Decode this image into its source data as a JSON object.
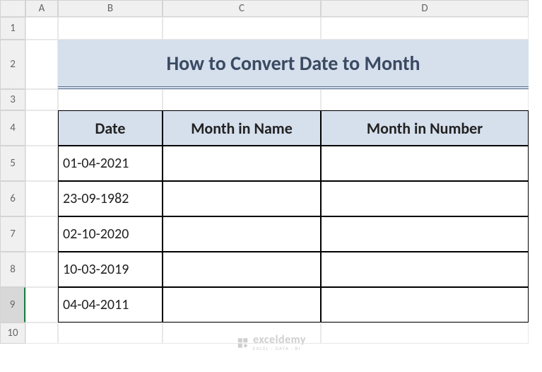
{
  "columns": [
    "A",
    "B",
    "C",
    "D"
  ],
  "rows": [
    "1",
    "2",
    "3",
    "4",
    "5",
    "6",
    "7",
    "8",
    "9",
    "10"
  ],
  "selected_row": "9",
  "title": "How to Convert Date to Month",
  "table": {
    "headers": [
      "Date",
      "Month in Name",
      "Month in Number"
    ],
    "data": [
      {
        "date": "01-04-2021",
        "month_name": "",
        "month_number": ""
      },
      {
        "date": "23-09-1982",
        "month_name": "",
        "month_number": ""
      },
      {
        "date": "02-10-2020",
        "month_name": "",
        "month_number": ""
      },
      {
        "date": "10-03-2019",
        "month_name": "",
        "month_number": ""
      },
      {
        "date": "04-04-2011",
        "month_name": "",
        "month_number": ""
      }
    ]
  },
  "watermark": {
    "brand": "exceldemy",
    "tagline": "EXCEL · DATA · BI"
  }
}
